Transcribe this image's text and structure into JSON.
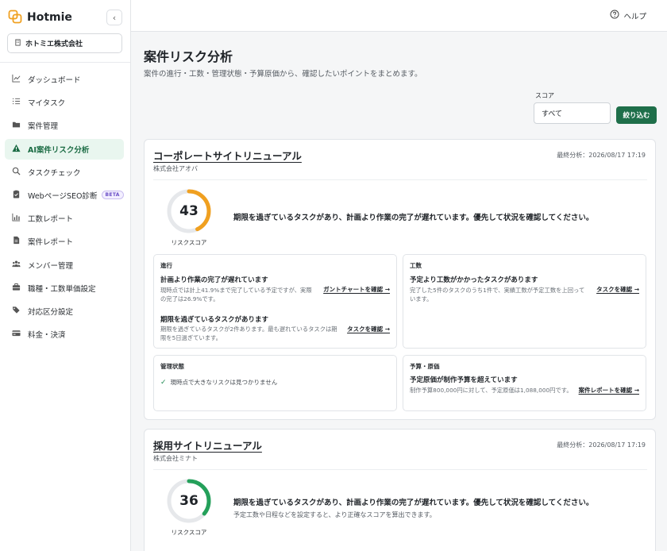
{
  "app": {
    "name": "Hotmie",
    "collapse_icon": "chevron-left-icon"
  },
  "company": {
    "name": "ホトミエ株式会社",
    "icon": "building-icon"
  },
  "nav": [
    {
      "label": "ダッシュボード",
      "icon": "chart-line-icon",
      "active": false
    },
    {
      "label": "マイタスク",
      "icon": "list-check-icon",
      "active": false
    },
    {
      "label": "案件管理",
      "icon": "folder-icon",
      "active": false
    },
    {
      "label": "AI案件リスク分析",
      "icon": "warning-triangle-icon",
      "active": true
    },
    {
      "label": "タスクチェック",
      "icon": "search-icon",
      "active": false
    },
    {
      "label": "WebページSEO診断",
      "icon": "clipboard-check-icon",
      "active": false,
      "badge": "BETA"
    },
    {
      "label": "工数レポート",
      "icon": "bar-chart-icon",
      "active": false
    },
    {
      "label": "案件レポート",
      "icon": "document-icon",
      "active": false
    },
    {
      "label": "メンバー管理",
      "icon": "users-icon",
      "active": false
    },
    {
      "label": "職種・工数単価設定",
      "icon": "briefcase-icon",
      "active": false
    },
    {
      "label": "対応区分設定",
      "icon": "tags-icon",
      "active": false
    },
    {
      "label": "料金・決済",
      "icon": "credit-card-icon",
      "active": false
    }
  ],
  "topbar": {
    "help_label": "ヘルプ",
    "help_icon": "question-circle-icon"
  },
  "page": {
    "title": "案件リスク分析",
    "description": "案件の進行・工数・管理状態・予算原価から、確認したいポイントをまとめます。"
  },
  "filter": {
    "label": "スコア",
    "selected": "すべて",
    "button": "絞り込む"
  },
  "colors": {
    "accent": "#1f6f4a",
    "gauge_orange": "#f0a020",
    "gauge_green": "#24a05a",
    "gauge_track": "#e6e8eb",
    "check": "#1f8a52"
  },
  "projects": [
    {
      "name": "コーポレートサイトリニューアル",
      "company": "株式会社アオバ",
      "last_analysis": "最終分析：2026/08/17 17:19",
      "score": 43,
      "score_label": "リスクスコア",
      "summary": "期限を過ぎているタスクがあり、計画より作業の完了が遅れています。優先して状況を確認してください。",
      "progress": {
        "category": "進行",
        "issues": [
          {
            "title": "計画より作業の完了が遅れています",
            "desc": "現時点では計上41.9%まで完了している予定ですが、実際の完了は26.9%です。",
            "link": "ガントチャートを確認 →"
          },
          {
            "title": "期限を過ぎているタスクがあります",
            "desc": "期限を過ぎているタスクが2件あります。最も遅れているタスクは期限を5日過ぎています。",
            "link": "タスクを確認 →"
          }
        ]
      },
      "effort": {
        "category": "工数",
        "issue": {
          "title": "予定より工数がかかったタスクがあります",
          "desc": "完了した5件のタスクのうち1件で、実績工数が予定工数を上回っています。",
          "link": "タスクを確認 →"
        }
      },
      "management": {
        "category": "管理状態",
        "ok_text": "現時点で大きなリスクは見つかりません"
      },
      "budget": {
        "category": "予算・原価",
        "issue": {
          "title": "予定原価が制作予算を超えています",
          "desc": "制作予算800,000円に対して、予定原価は1,088,000円です。",
          "link": "案件レポートを確認 →"
        }
      }
    },
    {
      "name": "採用サイトリニューアル",
      "company": "株式会社ミナト",
      "last_analysis": "最終分析：2026/08/17 17:19",
      "score": 36,
      "score_label": "リスクスコア",
      "summary": "期限を過ぎているタスクがあり、計画より作業の完了が遅れています。優先して状況を確認してください。",
      "note": "予定工数や日程などを設定すると、より正確なスコアを算出できます。"
    }
  ]
}
